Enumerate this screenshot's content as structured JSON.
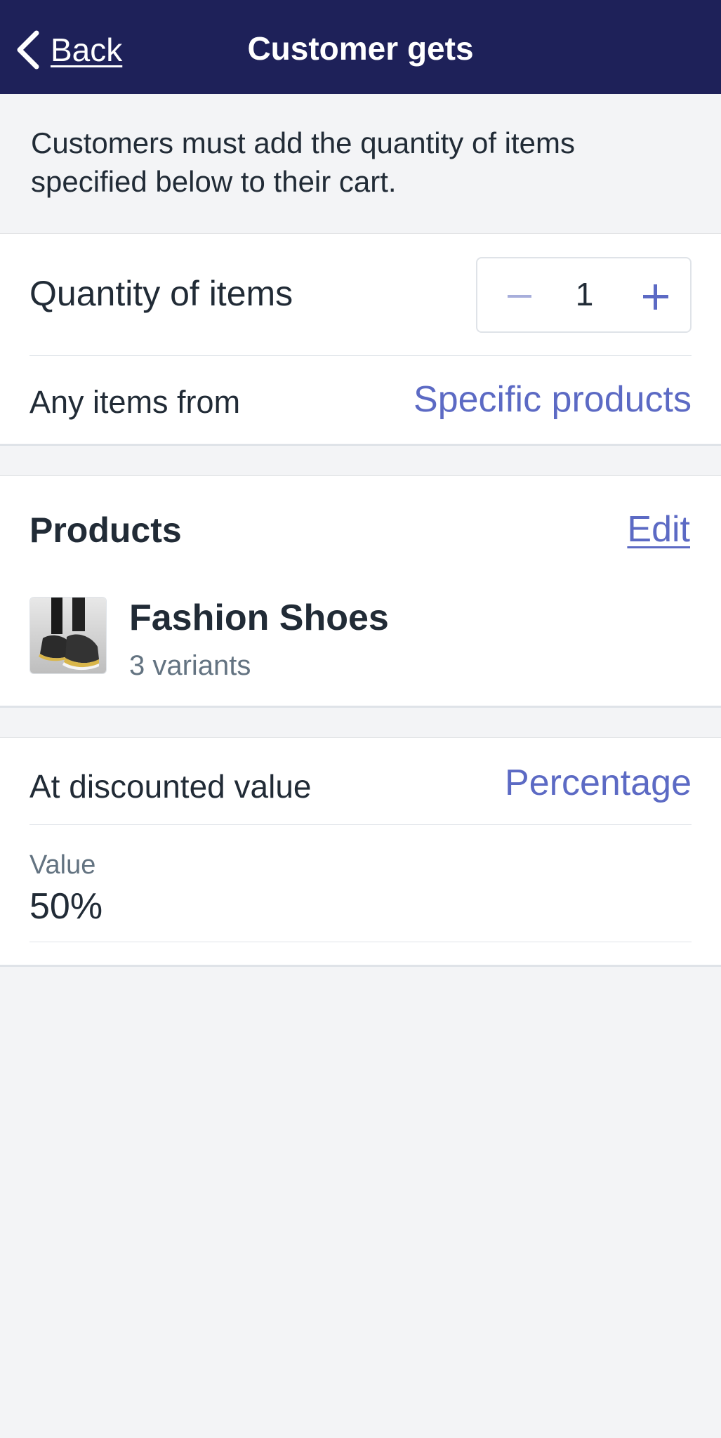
{
  "header": {
    "back_label": "Back",
    "title": "Customer gets",
    "back_icon": "chevron-left-icon"
  },
  "intro": {
    "text": "Customers must add the quantity of items specified below to their cart."
  },
  "quantity": {
    "label": "Quantity of items",
    "value": "1",
    "minus_icon": "minus-icon",
    "plus_icon": "plus-icon"
  },
  "any_items": {
    "label": "Any items from",
    "value": "Specific products"
  },
  "products": {
    "title": "Products",
    "edit_label": "Edit",
    "items": [
      {
        "name": "Fashion Shoes",
        "variants": "3 variants",
        "thumb_icon": "product-thumbnail"
      }
    ]
  },
  "discount": {
    "label": "At discounted value",
    "value": "Percentage",
    "field_caption": "Value",
    "field_value": "50%"
  },
  "colors": {
    "nav_bg": "#1e2159",
    "accent": "#5c6ac4",
    "text": "#212b36",
    "muted": "#637381",
    "background": "#f3f4f6"
  }
}
